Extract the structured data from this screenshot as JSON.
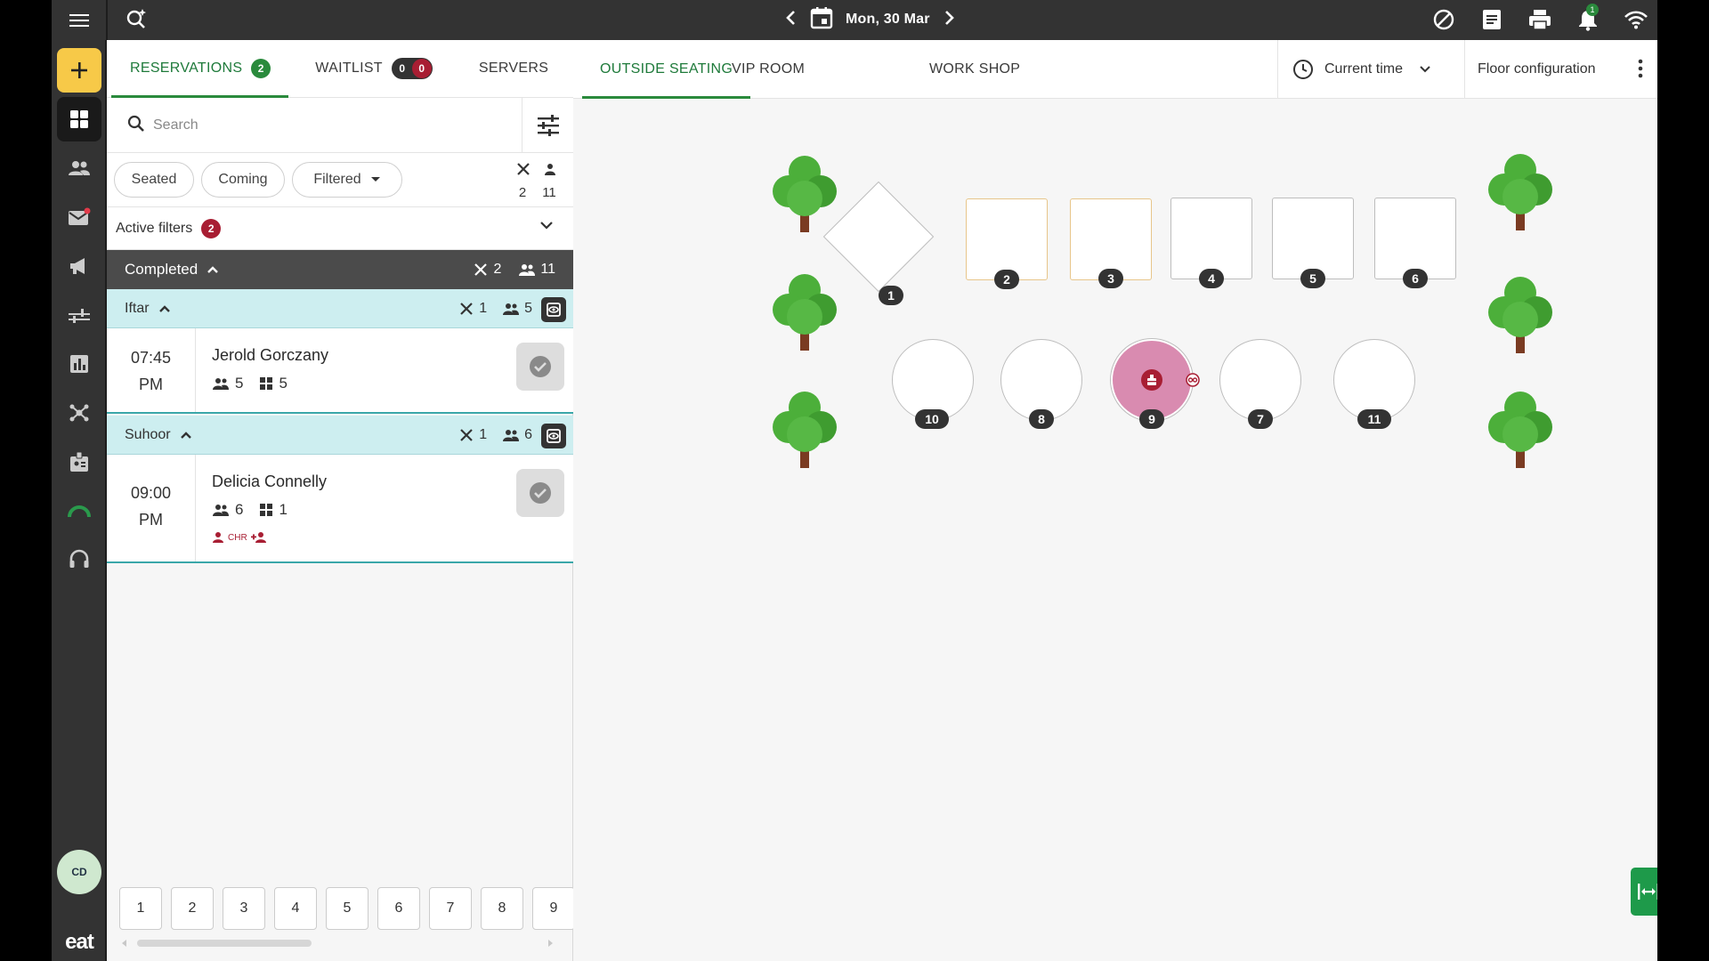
{
  "topbar": {
    "date": "Mon, 30 Mar",
    "notifications_count": "1",
    "icons": [
      "menu-icon",
      "search-ai-icon",
      "chevron-left-icon",
      "calendar-icon",
      "chevron-right-icon",
      "block-icon",
      "notes-icon",
      "printer-icon",
      "bell-icon",
      "wifi-icon"
    ]
  },
  "sidebar": {
    "items": [
      "add",
      "dashboard",
      "guests",
      "messages",
      "marketing",
      "settings-sliders",
      "reports",
      "integrations",
      "staff",
      "speed",
      "support"
    ],
    "avatar": "CD",
    "logo": "eat"
  },
  "left_tabs": [
    {
      "label": "RESERVATIONS",
      "count": "2"
    },
    {
      "label": "WAITLIST",
      "count_a": "0",
      "count_b": "0"
    },
    {
      "label": "SERVERS"
    }
  ],
  "search": {
    "placeholder": "Search"
  },
  "chips": [
    {
      "label": "Seated"
    },
    {
      "label": "Coming"
    },
    {
      "label": "Filtered"
    }
  ],
  "totals": {
    "reservations": "2",
    "covers": "11"
  },
  "active_filters": {
    "label": "Active filters",
    "count": "2"
  },
  "completed": {
    "label": "Completed",
    "reservations": "2",
    "covers": "11"
  },
  "groups": [
    {
      "label": "Iftar",
      "reservations": "1",
      "covers": "5",
      "items": [
        {
          "time": "07:45",
          "ampm": "PM",
          "name": "Jerold Gorczany",
          "guests": "5",
          "tables": "5"
        }
      ]
    },
    {
      "label": "Suhoor",
      "reservations": "1",
      "covers": "6",
      "items": [
        {
          "time": "09:00",
          "ampm": "PM",
          "name": "Delicia Connelly",
          "guests": "6",
          "tables": "1",
          "tag": "CHR"
        }
      ]
    }
  ],
  "pagination": [
    "1",
    "2",
    "3",
    "4",
    "5",
    "6",
    "7",
    "8",
    "9"
  ],
  "floor_tabs": [
    "OUTSIDE SEATING",
    "VIP ROOM",
    "WORK SHOP"
  ],
  "time_select": "Current time",
  "floor_config": "Floor configuration",
  "tables": [
    "1",
    "2",
    "3",
    "4",
    "5",
    "6",
    "10",
    "8",
    "9",
    "7",
    "11"
  ],
  "colors": {
    "accent": "#2a8a3c",
    "badge_red": "#a81e33",
    "topbar": "#333333",
    "occupied_table": "#d98bb0",
    "shift_bg": "#cdeef0",
    "add_button": "#f7c948"
  }
}
